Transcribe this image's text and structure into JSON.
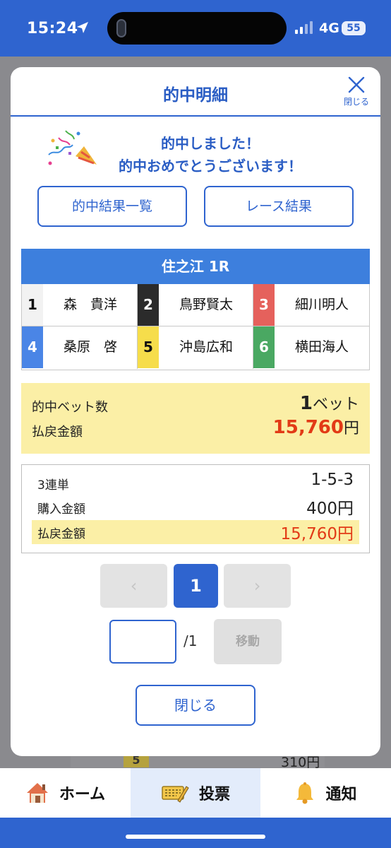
{
  "status_bar": {
    "time": "15:24",
    "network": "4G",
    "battery": "55"
  },
  "modal": {
    "title": "的中明細",
    "close_label": "閉じる",
    "congrats_line1": "的中しました！",
    "congrats_line2": "的中おめでとうございます！",
    "btn_results": "的中結果一覧",
    "btn_race": "レース結果",
    "race_title": "住之江 1R",
    "racers": [
      {
        "lane": "1",
        "name": "森　貴洋",
        "lane_bg": "#f2f2f2",
        "lane_color": "#111111"
      },
      {
        "lane": "2",
        "name": "鳥野賢太",
        "lane_bg": "#2b2b2b",
        "lane_color": "#ffffff"
      },
      {
        "lane": "3",
        "name": "細川明人",
        "lane_bg": "#e5615c",
        "lane_color": "#ffffff"
      },
      {
        "lane": "4",
        "name": "桑原　啓",
        "lane_bg": "#4a85e6",
        "lane_color": "#ffffff"
      },
      {
        "lane": "5",
        "name": "沖島広和",
        "lane_bg": "#f6dd4b",
        "lane_color": "#111111"
      },
      {
        "lane": "6",
        "name": "横田海人",
        "lane_bg": "#4aa862",
        "lane_color": "#ffffff"
      }
    ],
    "summary": {
      "hit_bets_label": "的中ベット数",
      "hit_bets_value": "1",
      "hit_bets_unit": "ベット",
      "payout_label": "払戻金額",
      "payout_value": "15,760",
      "payout_unit": "円"
    },
    "detail": {
      "bet_type": "3連単",
      "combination": "1-5-3",
      "purchase_label": "購入金額",
      "purchase_value": "400円",
      "payout_label": "払戻金額",
      "payout_value": "15,760円"
    },
    "pagination": {
      "prev": "‹",
      "current": "1",
      "next": "›",
      "input_value": "",
      "total": "/1",
      "move": "移動"
    },
    "close_button": "閉じる"
  },
  "background": {
    "lane_badge": "5",
    "amount": "310円"
  },
  "nav": {
    "home": "ホーム",
    "vote": "投票",
    "notify": "通知"
  },
  "colors": {
    "primary": "#2f64cf",
    "highlight": "#fbefa6",
    "payout_red": "#e23a16"
  }
}
